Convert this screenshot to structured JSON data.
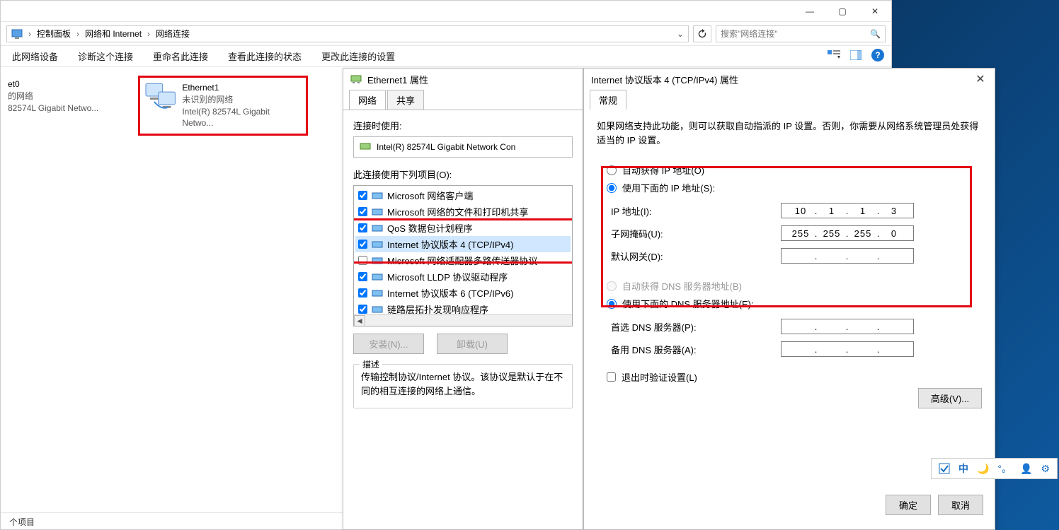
{
  "window_controls": {
    "minimize": "—",
    "maximize": "▢",
    "close": "✕"
  },
  "breadcrumb": {
    "seg1": "控制面板",
    "seg2": "网络和 Internet",
    "seg3": "网络连接"
  },
  "search": {
    "placeholder": "搜索\"网络连接\""
  },
  "toolbar": {
    "t1": "此网络设备",
    "t2": "诊断这个连接",
    "t3": "重命名此连接",
    "t4": "查看此连接的状态",
    "t5": "更改此连接的设置"
  },
  "adapters": {
    "left": {
      "name": "et0",
      "line2": "的网络",
      "line3": "82574L Gigabit Netwo..."
    },
    "right": {
      "name": "Ethernet1",
      "line2": "未识别的网络",
      "line3": "Intel(R) 82574L Gigabit Netwo..."
    }
  },
  "status_bar": "个项目",
  "props_dialog": {
    "title_icon_alt": "network-adapter",
    "title": "Ethernet1 属性",
    "tab_net": "网络",
    "tab_share": "共享",
    "connect_using": "连接时使用:",
    "adapter_name": "Intel(R) 82574L Gigabit Network Con",
    "uses_label": "此连接使用下列项目(O):",
    "items": [
      {
        "checked": true,
        "label": "Microsoft 网络客户端"
      },
      {
        "checked": true,
        "label": "Microsoft 网络的文件和打印机共享"
      },
      {
        "checked": true,
        "label": "QoS 数据包计划程序"
      },
      {
        "checked": true,
        "label": "Internet 协议版本 4 (TCP/IPv4)"
      },
      {
        "checked": false,
        "label": "Microsoft 网络适配器多路传送器协议"
      },
      {
        "checked": true,
        "label": "Microsoft LLDP 协议驱动程序"
      },
      {
        "checked": true,
        "label": "Internet 协议版本 6 (TCP/IPv6)"
      },
      {
        "checked": true,
        "label": "链路层拓扑发现响应程序"
      }
    ],
    "btn_install": "安装(N)...",
    "btn_uninstall": "卸载(U)",
    "desc_legend": "描述",
    "desc_text": "传输控制协议/Internet 协议。该协议是默认于在不同的相互连接的网络上通信。"
  },
  "ipv4_dialog": {
    "title": "Internet 协议版本 4 (TCP/IPv4) 属性",
    "tab_general": "常规",
    "intro": "如果网络支持此功能，则可以获取自动指派的 IP 设置。否则，你需要从网络系统管理员处获得适当的 IP 设置。",
    "radio_auto_ip": "自动获得 IP 地址(O)",
    "radio_manual_ip": "使用下面的 IP 地址(S):",
    "ip_label": "IP 地址(I):",
    "ip_value": [
      "10",
      "1",
      "1",
      "3"
    ],
    "mask_label": "子网掩码(U):",
    "mask_value": [
      "255",
      "255",
      "255",
      "0"
    ],
    "gw_label": "默认网关(D):",
    "gw_value": [
      "",
      "",
      "",
      ""
    ],
    "radio_auto_dns": "自动获得 DNS 服务器地址(B)",
    "radio_manual_dns": "使用下面的 DNS 服务器地址(E):",
    "dns1_label": "首选 DNS 服务器(P):",
    "dns2_label": "备用 DNS 服务器(A):",
    "validate_label": "退出时验证设置(L)",
    "advanced": "高级(V)...",
    "ok": "确定",
    "cancel": "取消"
  },
  "ime": {
    "ch": "中",
    "moon": "🌙",
    "dots": "°。",
    "person": "👤",
    "gear": "⚙"
  }
}
